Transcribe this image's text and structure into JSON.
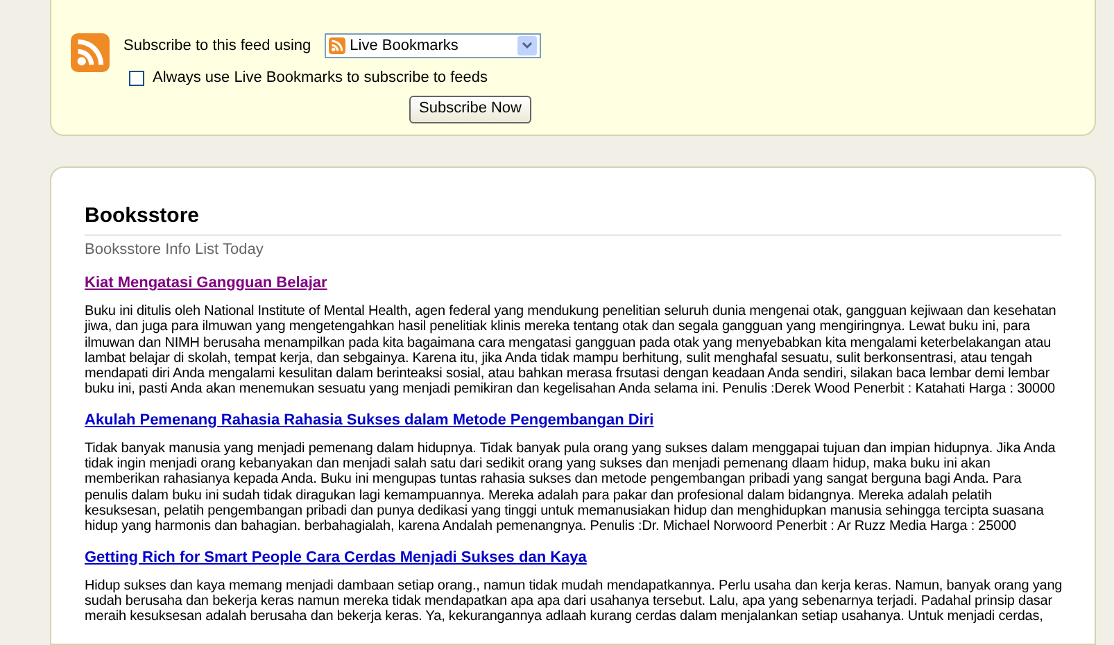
{
  "subscribe_panel": {
    "label": "Subscribe to this feed using",
    "reader_select": {
      "value": "Live Bookmarks"
    },
    "always_use": {
      "label": "Always use Live Bookmarks to subscribe to feeds",
      "checked": false
    },
    "button": "Subscribe Now"
  },
  "feed": {
    "title": "Booksstore",
    "subtitle": "Booksstore Info List Today",
    "entries": [
      {
        "title": "Kiat Mengatasi Gangguan Belajar",
        "visited": true,
        "body": "Buku ini ditulis oleh National Institute of Mental Health, agen federal yang mendukung penelitian seluruh dunia mengenai otak, gangguan kejiwaan dan kesehatan jiwa, dan juga para ilmuwan yang mengetengahkan hasil penelitiak klinis mereka tentang otak dan segala gangguan yang mengiringnya. Lewat buku ini, para ilmuwan dan NIMH berusaha menampilkan pada kita bagaimana cara mengatasi gangguan pada otak yang menyebabkan kita mengalami keterbelakangan atau lambat belajar di skolah, tempat kerja, dan sebgainya. Karena itu, jika Anda tidak mampu berhitung, sulit menghafal sesuatu, sulit berkonsentrasi, atau tengah mendapati diri Anda mengalami kesulitan dalam berinteaksi sosial, atau bahkan merasa frsutasi dengan keadaan Anda sendiri, silakan baca lembar demi lembar buku ini, pasti Anda akan menemukan sesuatu yang menjadi pemikiran dan kegelisahan Anda selama ini. Penulis :Derek Wood Penerbit : Katahati Harga : 30000"
      },
      {
        "title": "Akulah Pemenang Rahasia Rahasia Sukses dalam Metode Pengembangan Diri",
        "visited": false,
        "body": "Tidak banyak manusia yang menjadi pemenang dalam hidupnya. Tidak banyak pula orang yang sukses dalam menggapai tujuan dan impian hidupnya. Jika Anda tidak ingin menjadi orang kebanyakan dan menjadi salah satu dari sedikit orang yang sukses dan menjadi pemenang dlaam hidup, maka buku ini akan memberikan rahasianya kepada Anda. Buku ini mengupas tuntas rahasia sukses dan metode pengembangan pribadi yang sangat berguna bagi Anda. Para penulis dalam buku ini sudah tidak diragukan lagi kemampuannya. Mereka adalah para pakar dan profesional dalam bidangnya. Mereka adalah pelatih kesuksesan, pelatih pengembangan pribadi dan punya dedikasi yang tinggi untuk memanusiakan hidup dan menghidupkan manusia sehingga tercipta suasana hidup yang harmonis dan bahagian. berbahagialah, karena Andalah pemenangnya. Penulis :Dr. Michael Norwoord Penerbit : Ar Ruzz Media Harga : 25000"
      },
      {
        "title": "Getting Rich for Smart People Cara Cerdas Menjadi Sukses dan Kaya",
        "visited": false,
        "body": "Hidup sukses dan kaya memang menjadi dambaan setiap orang., namun tidak mudah mendapatkannya. Perlu usaha dan kerja keras. Namun, banyak orang yang sudah berusaha dan bekerja keras namun mereka tidak mendapatkan apa apa dari usahanya tersebut. Lalu, apa yang sebenarnya terjadi. Padahal prinsip dasar meraih kesuksesan adalah berusaha dan bekerja keras. Ya, kekurangannya adlaah kurang cerdas dalam menjalankan setiap usahanya. Untuk menjadi cerdas,"
      }
    ]
  }
}
